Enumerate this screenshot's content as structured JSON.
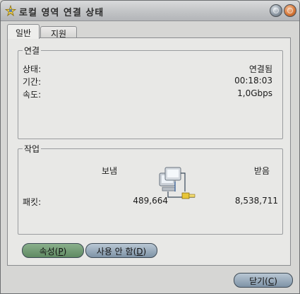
{
  "window": {
    "title": "로컬 영역 연결 상태",
    "icon": "network-star-icon",
    "controls": {
      "minimize_icon": "minimize-icon",
      "close_icon": "close-icon"
    }
  },
  "tabs": [
    {
      "label": "일반",
      "selected": true
    },
    {
      "label": "지원",
      "selected": false
    }
  ],
  "connection": {
    "legend": "연결",
    "rows": [
      {
        "label": "상태:",
        "value": "연결됨"
      },
      {
        "label": "기간:",
        "value": "00:18:03"
      },
      {
        "label": "속도:",
        "value": "1,0Gbps"
      }
    ]
  },
  "activity": {
    "legend": "작업",
    "sent_label": "보냄",
    "received_label": "받음",
    "packets_label": "패킷:",
    "packets_sent": "489,664",
    "packets_received": "8,538,711",
    "icon": "network-computers-icon"
  },
  "buttons": {
    "properties": {
      "label": "속성",
      "hotkey_open": "(",
      "hotkey": "P",
      "hotkey_close": ")"
    },
    "disable": {
      "label": "사용 안 함",
      "hotkey_open": "(",
      "hotkey": "D",
      "hotkey_close": ")"
    },
    "close": {
      "label": "닫기",
      "hotkey_open": "(",
      "hotkey": "C",
      "hotkey_close": ")"
    }
  },
  "colors": {
    "properties_button": "#6f9a72",
    "other_buttons": "#9aacbd",
    "close_control": "#d77a3c"
  }
}
